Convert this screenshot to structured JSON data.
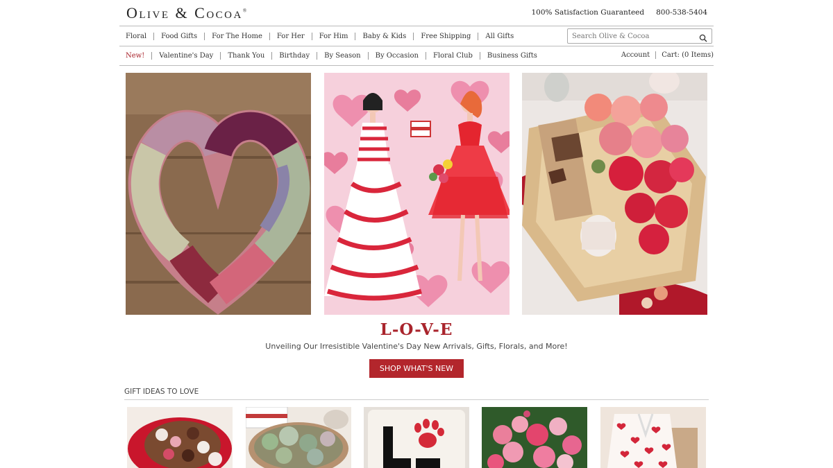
{
  "brand": {
    "name": "Olive & Cocoa",
    "registered": "®"
  },
  "header": {
    "guarantee": "100% Satisfaction Guaranteed",
    "phone": "800-538-5404"
  },
  "nav_primary": [
    {
      "label": "Floral"
    },
    {
      "label": "Food Gifts"
    },
    {
      "label": "For The Home"
    },
    {
      "label": "For Her"
    },
    {
      "label": "For Him"
    },
    {
      "label": "Baby & Kids"
    },
    {
      "label": "Free Shipping"
    },
    {
      "label": "All Gifts"
    }
  ],
  "search": {
    "placeholder": "Search Olive & Cocoa",
    "icon": "search-icon"
  },
  "nav_secondary": [
    {
      "label": "New!"
    },
    {
      "label": "Valentine's Day"
    },
    {
      "label": "Thank You"
    },
    {
      "label": "Birthday"
    },
    {
      "label": "By Season"
    },
    {
      "label": "By Occasion"
    },
    {
      "label": "Floral Club"
    },
    {
      "label": "Business Gifts"
    }
  ],
  "account": {
    "account_label": "Account",
    "cart_label": "Cart: (0 Items)"
  },
  "hero": {
    "title": "L-O-V-E",
    "subtitle": "Unveiling Our Irresistible Valentine's Day New Arrivals, Gifts, Florals, and More!",
    "cta": "SHOP WHAT'S NEW",
    "accent_color": "#b3262c"
  },
  "gifts": {
    "heading": "GIFT IDEAS TO LOVE"
  }
}
